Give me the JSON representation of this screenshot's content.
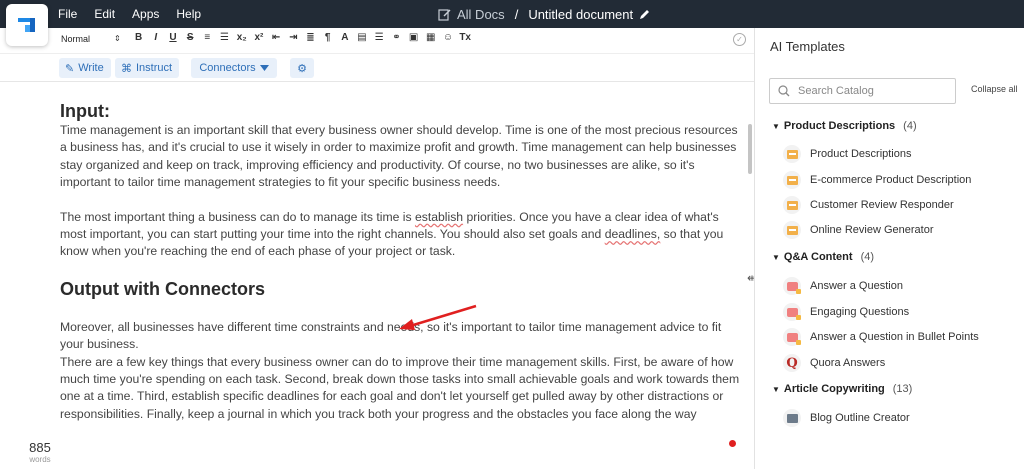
{
  "menu": {
    "file": "File",
    "edit": "Edit",
    "apps": "Apps",
    "help": "Help"
  },
  "breadcrumb": {
    "root": "All Docs",
    "separator": "/",
    "title": "Untitled document"
  },
  "toolbar": {
    "paragraph_style": "Normal"
  },
  "actions": {
    "write": "Write",
    "instruct": "Instruct",
    "connectors": "Connectors"
  },
  "document": {
    "heading1": "Input:",
    "p1": "Time management is an important skill that every business owner should develop. Time is one of the most precious resources a business has, and it's crucial to use it wisely in order to maximize profit and growth. Time management can help businesses stay organized and keep on track, improving efficiency and productivity. Of course, no two businesses are alike, so it's important to tailor time management strategies to fit your specific business needs.",
    "p2_a": "The most important thing a business can do to manage its time is ",
    "p2_u1": "establish",
    "p2_b": " priorities. Once you have a clear idea of what's most important, you can start putting your time into the right channels. You should also set goals and ",
    "p2_u2": "deadlines,",
    "p2_c": " so that you know when you're reaching the end of each phase of your project or task.",
    "heading2": "Output with Connectors",
    "p3": "Moreover, all businesses have different time constraints and needs, so it's important to tailor time management advice to fit your business.",
    "p4": "There are a few key things that every business owner can do to improve their time management skills. First, be aware of how much time you're spending on each task. Second, break down those tasks into small achievable goals and work towards them one at a time. Third, establish specific deadlines for each goal and don't let yourself get pulled away by other distractions or responsibilities. Finally, keep a journal in which you track both your progress and the obstacles you face along the way"
  },
  "wordcount": {
    "value": "885",
    "label": "words"
  },
  "panel": {
    "title": "AI Templates",
    "search_placeholder": "Search Catalog",
    "collapse_all": "Collapse all",
    "categories": [
      {
        "name": "Product Descriptions",
        "count": "(4)",
        "items": [
          "Product Descriptions",
          "E-commerce Product Description",
          "Customer Review Responder",
          "Online Review Generator"
        ]
      },
      {
        "name": "Q&A Content",
        "count": "(4)",
        "items": [
          "Answer a Question",
          "Engaging Questions",
          "Answer a Question in Bullet Points",
          "Quora Answers"
        ]
      },
      {
        "name": "Article Copywriting",
        "count": "(13)",
        "items": [
          "Blog Outline Creator"
        ]
      }
    ]
  },
  "colors": {
    "topbar": "#222b36",
    "accent": "#2e6fb8",
    "arrow": "#e02020"
  }
}
